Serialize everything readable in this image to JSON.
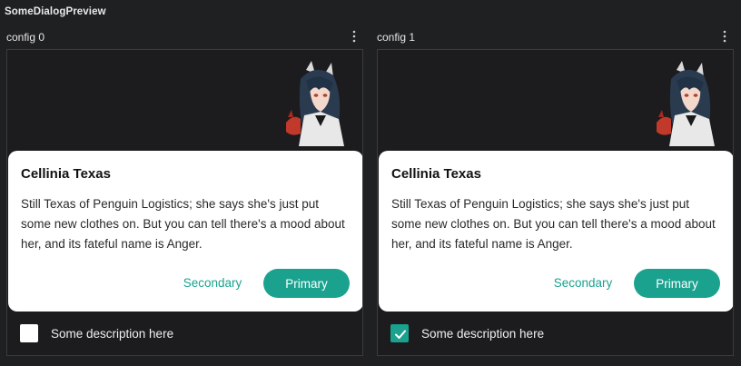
{
  "preview_title": "SomeDialogPreview",
  "colors": {
    "accent": "#1aa28f",
    "background": "#1f2022",
    "dialog_background": "#ffffff"
  },
  "panels": [
    {
      "config_label": "config 0",
      "more_icon": "more-vertical-icon",
      "dialog": {
        "title": "Cellinia Texas",
        "body": "Still Texas of Penguin Logistics; she says she's just put some new clothes on. But you can tell there's a mood about her, and its fateful name is Anger.",
        "secondary_label": "Secondary",
        "primary_label": "Primary"
      },
      "checkbox": {
        "checked": false,
        "label": "Some description here"
      }
    },
    {
      "config_label": "config 1",
      "more_icon": "more-vertical-icon",
      "dialog": {
        "title": "Cellinia Texas",
        "body": "Still Texas of Penguin Logistics; she says she's just put some new clothes on. But you can tell there's a mood about her, and its fateful name is Anger.",
        "secondary_label": "Secondary",
        "primary_label": "Primary"
      },
      "checkbox": {
        "checked": true,
        "label": "Some description here"
      }
    }
  ]
}
